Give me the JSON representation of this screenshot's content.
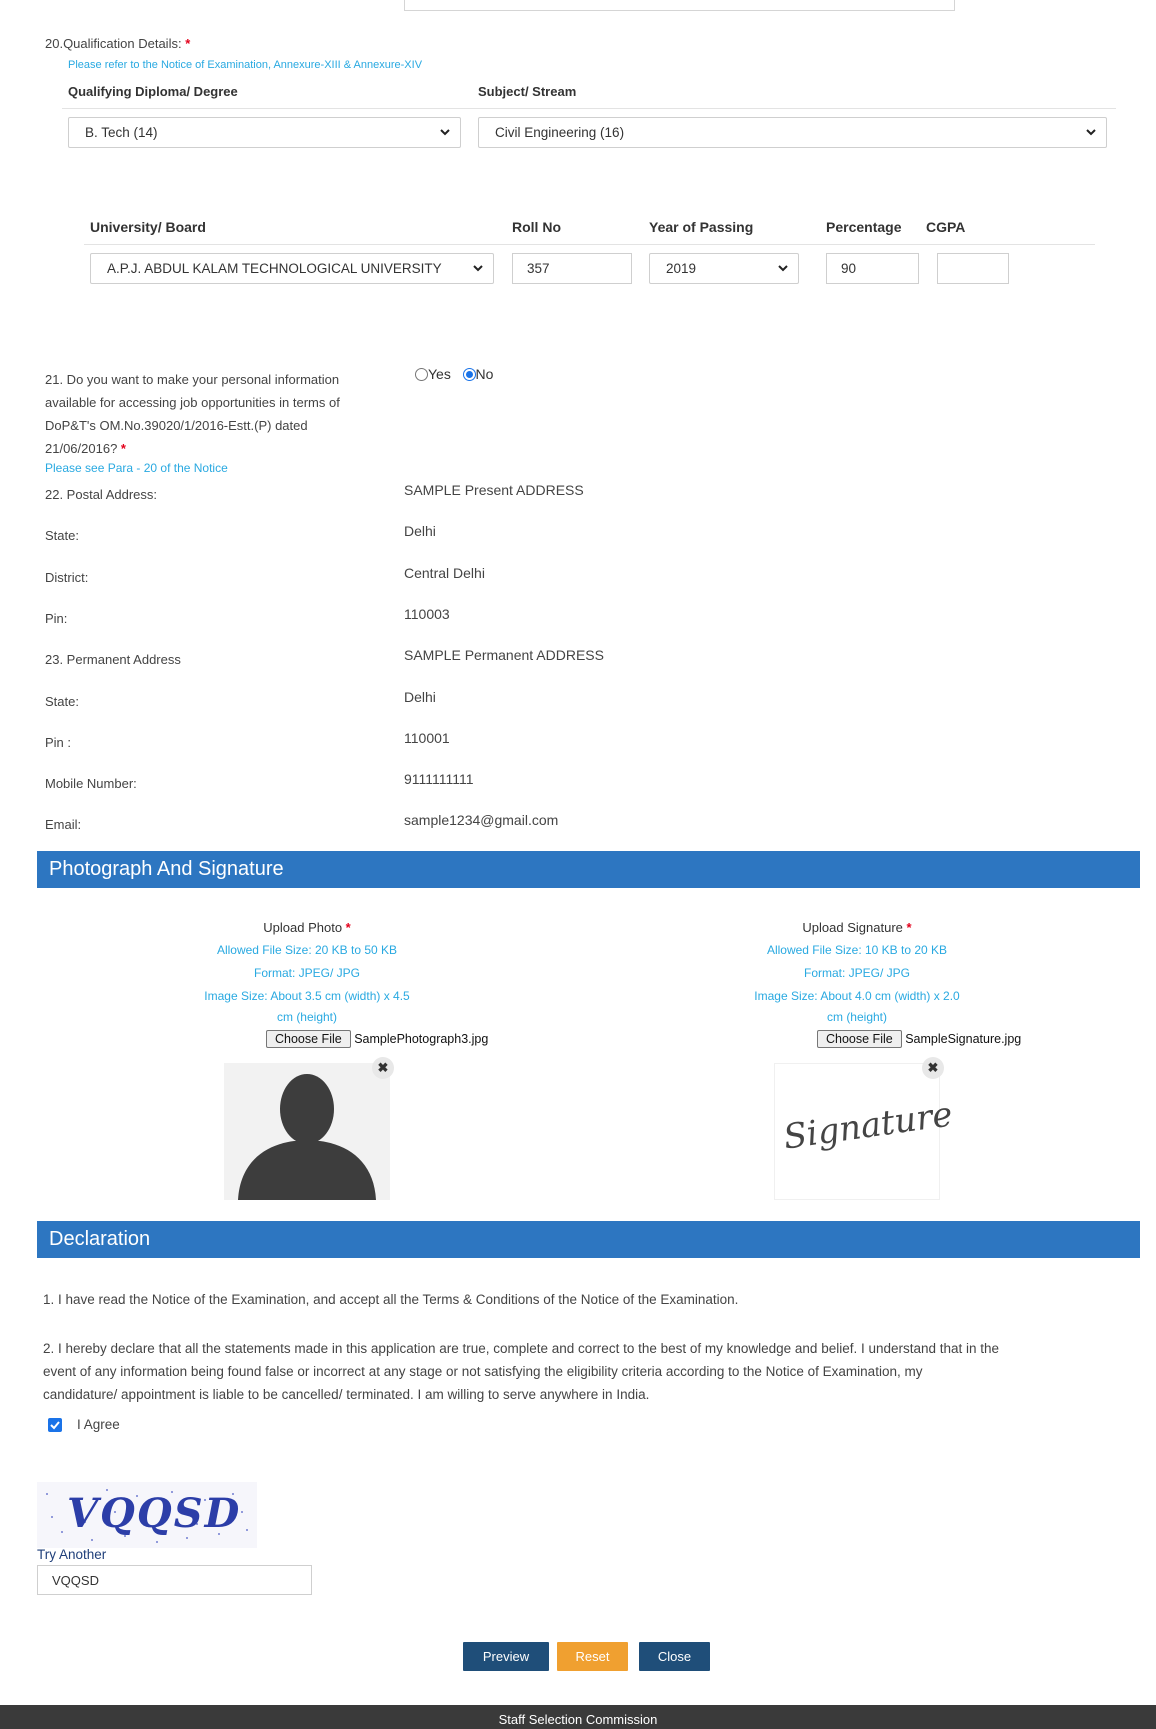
{
  "q20": {
    "label": "20.Qualification Details:",
    "required": "*",
    "note": "Please refer to the Notice of Examination, Annexure-XIII & Annexure-XIV",
    "col_degree": "Qualifying Diploma/ Degree",
    "col_subject": "Subject/ Stream",
    "degree_value": "B. Tech (14)",
    "subject_value": "Civil Engineering (16)",
    "col_university": "University/ Board",
    "col_roll": "Roll No",
    "col_year": "Year of Passing",
    "col_percentage": "Percentage",
    "col_cgpa": "CGPA",
    "university_value": "A.P.J. ABDUL KALAM TECHNOLOGICAL UNIVERSITY",
    "roll_value": "357",
    "year_value": "2019",
    "percentage_value": "90",
    "cgpa_value": ""
  },
  "q21": {
    "line1": "21. Do you want to make your personal information",
    "line2": "available for accessing job opportunities in terms of",
    "line3": "DoP&T's OM.No.39020/1/2016-Estt.(P) dated",
    "line4": "21/06/2016?",
    "required": "*",
    "note": "Please see Para - 20 of the Notice",
    "yes_label": "Yes",
    "no_label": "No",
    "selected": "No"
  },
  "details": [
    {
      "label": "22. Postal Address:",
      "value": "SAMPLE Present ADDRESS"
    },
    {
      "label": "State:",
      "value": "Delhi"
    },
    {
      "label": "District:",
      "value": "Central Delhi"
    },
    {
      "label": "Pin:",
      "value": "110003"
    },
    {
      "label": "23. Permanent Address",
      "value": "SAMPLE Permanent ADDRESS"
    },
    {
      "label": "State:",
      "value": "Delhi"
    },
    {
      "label": "Pin :",
      "value": "110001"
    },
    {
      "label": "Mobile Number:",
      "value": "9111111111"
    },
    {
      "label": "Email:",
      "value": "sample1234@gmail.com"
    }
  ],
  "photo_section": {
    "title": "Photograph And Signature",
    "photo": {
      "title": "Upload Photo",
      "required": "*",
      "size": "Allowed File Size: 20 KB to 50 KB",
      "format": "Format: JPEG/ JPG",
      "dims_line1": "Image Size: About 3.5 cm (width) x 4.5",
      "dims_line2": "cm (height)",
      "button": "Choose File",
      "filename": "SamplePhotograph3.jpg"
    },
    "signature": {
      "title": "Upload Signature",
      "required": "*",
      "size": "Allowed File Size: 10 KB to 20 KB",
      "format": "Format: JPEG/ JPG",
      "dims_line1": "Image Size: About 4.0 cm (width) x 2.0",
      "dims_line2": "cm (height)",
      "button": "Choose File",
      "filename": "SampleSignature.jpg",
      "image_text": "Signature"
    }
  },
  "declaration": {
    "title": "Declaration",
    "item1": "1. I have read the Notice of the Examination, and accept all the Terms & Conditions of the Notice of the Examination.",
    "item2_line1": "2. I hereby declare that all the statements made in this application are true, complete and correct to the best of my knowledge and belief. I understand that in the",
    "item2_line2": "event of any information being found false or incorrect at any stage or not satisfying the eligibility criteria according to the Notice of Examination, my",
    "item2_line3": "candidature/ appointment is liable to be cancelled/ terminated. I am willing to serve anywhere in India.",
    "agree_label": "I Agree",
    "agree_checked": true
  },
  "captcha": {
    "image_text": "VQQSD",
    "try_another": "Try Another",
    "input_value": "VQQSD"
  },
  "buttons": {
    "preview": "Preview",
    "reset": "Reset",
    "close": "Close"
  },
  "footer": {
    "text": "Staff Selection Commission"
  },
  "colors": {
    "section_bar": "#2d76c1",
    "preview_btn": "#1f4e79",
    "reset_btn": "#f0a030",
    "close_btn": "#1f4e79",
    "footer_bg": "#3a3a3a",
    "note_cyan": "#29a9e1"
  }
}
